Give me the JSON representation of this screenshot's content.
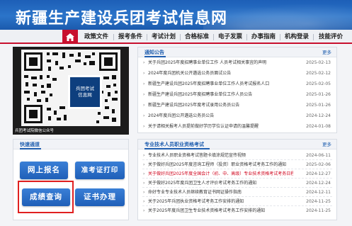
{
  "site": {
    "title": "新疆生产建设兵团考试信息网"
  },
  "nav": {
    "items": [
      "政策文件",
      "报考条件",
      "考试计划",
      "合格标准",
      "电子发票",
      "办事指南",
      "机构登录",
      "技能评价"
    ]
  },
  "qr": {
    "caption": "兵团考试院微信公众号",
    "seal_line1": "兵团考试",
    "seal_line2": "信息网"
  },
  "notice": {
    "title": "通知公告",
    "more": "更多",
    "items": [
      {
        "text": "关于兵团2025年度招聘事业单位工作 人员考试相关事宜的声明",
        "date": "2025-02-13"
      },
      {
        "text": "2024年度兵团机关公开遴选公务员面试公告",
        "date": "2025-02-12"
      },
      {
        "text": "新疆生产建设兵团2025年度招聘事业单位工作人员考试报名人口",
        "date": "2025-02-05"
      },
      {
        "text": "新疆生产建设兵团2025年度招聘事业单位工作人员公告",
        "date": "2025-01-26"
      },
      {
        "text": "新疆生产建设兵团2025年度考试录用公务员公告",
        "date": "2025-01-26"
      },
      {
        "text": "2024年度兵团公开遴选公务员公告",
        "date": "2024-12-24"
      },
      {
        "text": "关于请相关报考人员提前做好学历学位认证申请的温馨提醒",
        "date": "2024-01-08"
      }
    ]
  },
  "quick": {
    "title": "快速通道",
    "buttons": [
      "网上报名",
      "准考证打印",
      "成绩查询",
      "证书办理"
    ]
  },
  "prof": {
    "title": "专业技术人员职业资格考试",
    "more": "更多",
    "items": [
      {
        "text": "专业技术人员职业资格考试答题卡填涂规范宣传视频",
        "date": "2024-06-11",
        "red": false
      },
      {
        "text": "关于做好兵团2025年度咨询工程师（投资）职业资格考试考务工作的通知",
        "date": "2025-02-06",
        "red": false
      },
      {
        "text": "关于做好兵团2025年度全国会计（初、中、高级）专业技术资格考试考务日程...",
        "date": "2024-12-27",
        "red": true
      },
      {
        "text": "关于做好2025年度兵团卫生人才评价考试考务工作的通知",
        "date": "2024-12-24",
        "red": false
      },
      {
        "text": "命好专业专业技术人员继续教育证书网证操作指南",
        "date": "2024-12-11",
        "red": false
      },
      {
        "text": "关于2025年兵团执业资格考试考务工作安排的通知",
        "date": "2024-11-25",
        "red": false
      },
      {
        "text": "关于2025年度兵团卫生专业技术资格考试考务工作安排的通知",
        "date": "2024-11-25",
        "red": false
      }
    ]
  },
  "colors": {
    "brand_blue": "#1f5eaf",
    "nav_red": "#c8102e",
    "highlight_red": "#e02020"
  }
}
